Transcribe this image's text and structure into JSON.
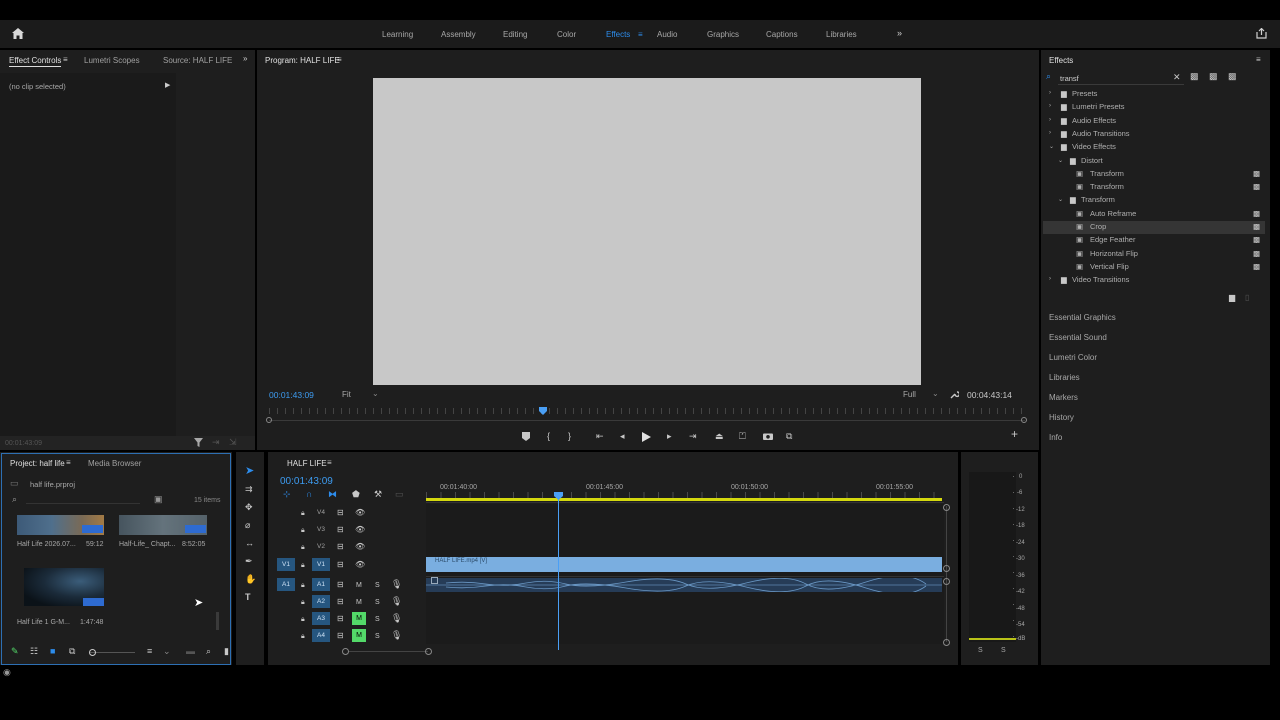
{
  "workspaces": [
    "Learning",
    "Assembly",
    "Editing",
    "Color",
    "Effects",
    "Audio",
    "Graphics",
    "Captions",
    "Libraries"
  ],
  "active_workspace": "Effects",
  "left_panel": {
    "tabs": [
      "Effect Controls",
      "Lumetri Scopes",
      "Source: HALF LIFE"
    ],
    "no_clip": "(no clip selected)",
    "timecode": "00:01:43:09"
  },
  "program": {
    "title": "Program: HALF LIFE",
    "timecode": "00:01:43:09",
    "fit": "Fit",
    "quality": "Full",
    "duration": "00:04:43:14"
  },
  "project": {
    "tabs": [
      "Project: half life",
      "Media Browser"
    ],
    "file": "half life.prproj",
    "items_count": "15 items",
    "clips": [
      {
        "name": "Half Life 2026.07...",
        "dur": "59:12"
      },
      {
        "name": "Half-Life_ Chapt...",
        "dur": "8:52:05"
      },
      {
        "name": "Half Life 1 G-M...",
        "dur": "1:47:48"
      }
    ]
  },
  "timeline": {
    "title": "HALF LIFE",
    "timecode": "00:01:43:09",
    "ruler": [
      "00:01:40:00",
      "00:01:45:00",
      "00:01:50:00",
      "00:01:55:00"
    ],
    "video_tracks": [
      "V4",
      "V3",
      "V2",
      "V1"
    ],
    "audio_tracks": [
      "A1",
      "A2",
      "A3",
      "A4"
    ],
    "clip_label": "HALF LIFE.mp4 [V]",
    "src_v": "V1",
    "src_a": "A1"
  },
  "meter_scale": [
    "0",
    "-6",
    "-12",
    "-18",
    "-24",
    "-30",
    "-36",
    "-42",
    "-48",
    "-54",
    "-dB"
  ],
  "meter_solo": [
    "S",
    "S"
  ],
  "effects": {
    "title": "Effects",
    "search": "transf",
    "tree": [
      {
        "label": "Presets",
        "level": 0,
        "type": "folder",
        "exp": "closed"
      },
      {
        "label": "Lumetri Presets",
        "level": 0,
        "type": "folder",
        "exp": "closed"
      },
      {
        "label": "Audio Effects",
        "level": 0,
        "type": "folder",
        "exp": "closed"
      },
      {
        "label": "Audio Transitions",
        "level": 0,
        "type": "folder",
        "exp": "closed"
      },
      {
        "label": "Video Effects",
        "level": 0,
        "type": "folder",
        "exp": "open"
      },
      {
        "label": "Distort",
        "level": 1,
        "type": "folder",
        "exp": "open"
      },
      {
        "label": "Transform",
        "level": 2,
        "type": "fx",
        "acc": true
      },
      {
        "label": "Transform",
        "level": 2,
        "type": "fx",
        "acc": true
      },
      {
        "label": "Transform",
        "level": 1,
        "type": "folder",
        "exp": "open"
      },
      {
        "label": "Auto Reframe",
        "level": 2,
        "type": "fx",
        "acc": true
      },
      {
        "label": "Crop",
        "level": 2,
        "type": "fx",
        "acc": true,
        "selected": true
      },
      {
        "label": "Edge Feather",
        "level": 2,
        "type": "fx",
        "acc": true
      },
      {
        "label": "Horizontal Flip",
        "level": 2,
        "type": "fx",
        "acc": true
      },
      {
        "label": "Vertical Flip",
        "level": 2,
        "type": "fx",
        "acc": true
      },
      {
        "label": "Video Transitions",
        "level": 0,
        "type": "folder",
        "exp": "closed"
      }
    ],
    "sections": [
      "Essential Graphics",
      "Essential Sound",
      "Lumetri Color",
      "Libraries",
      "Markers",
      "History",
      "Info"
    ]
  },
  "colors": {
    "accent": "#2d8ceb",
    "playhead": "#4a9ff5",
    "clip": "#7aaee0",
    "mute_green": "#53d969",
    "track_on": "#26567f"
  }
}
